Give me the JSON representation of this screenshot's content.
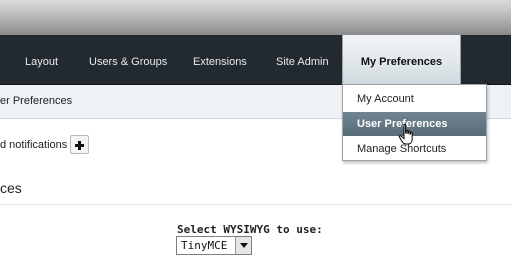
{
  "navbar": {
    "items": [
      {
        "label": "Layout"
      },
      {
        "label": "Users & Groups"
      },
      {
        "label": "Extensions"
      },
      {
        "label": "Site Admin"
      },
      {
        "label": "My Preferences"
      }
    ],
    "active_index": 4
  },
  "dropdown": {
    "items": [
      {
        "label": "My Account"
      },
      {
        "label": "User Preferences"
      },
      {
        "label": "Manage Shortcuts"
      }
    ],
    "hovered_index": 1
  },
  "breadcrumb": {
    "text": "er Preferences"
  },
  "notifications": {
    "label": "d notifications"
  },
  "section": {
    "title": "ces"
  },
  "wysiwyg": {
    "label": "Select WYSIWYG to use:",
    "selected": "TinyMCE"
  }
}
